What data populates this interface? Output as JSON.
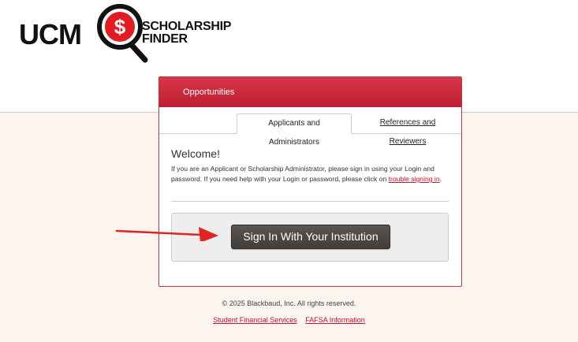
{
  "logo": {
    "ucm": "UCM",
    "line1": "SCHOLARSHIP",
    "line2": "FINDER",
    "glass_symbol": "$",
    "brand_color": "#e31b23"
  },
  "header": {
    "tab_opportunities": "Opportunities",
    "color": "#c8313d"
  },
  "tabs": [
    {
      "label": "Applicants and Administrators",
      "active": true
    },
    {
      "label": "References and Reviewers",
      "active": false
    }
  ],
  "welcome": {
    "title": "Welcome!",
    "text": "If you are an Applicant or Scholarship Administrator, please sign in using your Login and password. If you need help with your Login or password, please click on ",
    "link": "trouble signing in",
    "suffix": "."
  },
  "signin": {
    "button_label": "Sign In With Your Institution"
  },
  "annotation": {
    "arrow_color": "#e02424",
    "arrow_icon": "red-arrow-icon"
  },
  "footer": {
    "copyright": "© 2025 Blackbaud, Inc. All rights reserved.",
    "links": [
      "Student Financial Services",
      "FAFSA Information"
    ]
  }
}
